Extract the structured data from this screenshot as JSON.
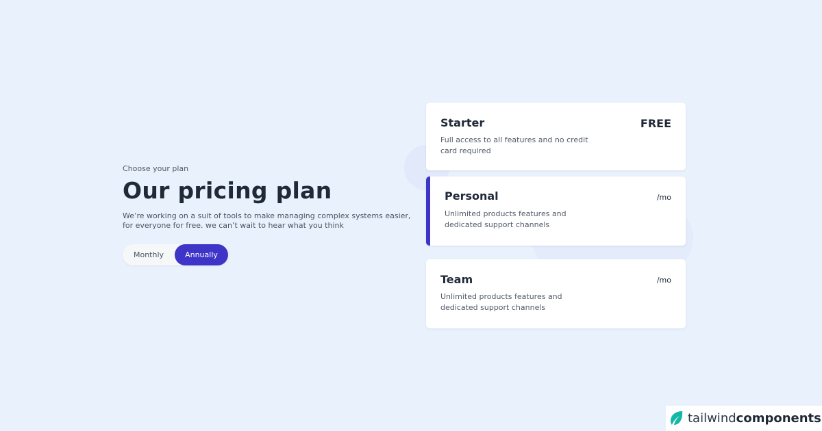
{
  "hero": {
    "eyebrow": "Choose your plan",
    "title": "Our pricing plan",
    "description": "We’re working on a suit of tools to make managing complex systems easier, for everyone for free. we can’t wait to hear what you think"
  },
  "billing_toggle": {
    "options": [
      "Monthly",
      "Annually"
    ],
    "selected": "Annually"
  },
  "plans": [
    {
      "name": "Starter",
      "price": "FREE",
      "description": "Full access to all features and no credit card required",
      "highlighted": false
    },
    {
      "name": "Personal",
      "price": "/mo",
      "description": "Unlimited products features and dedicated support channels",
      "highlighted": true
    },
    {
      "name": "Team",
      "price": "/mo",
      "description": "Unlimited products features and dedicated support channels",
      "highlighted": false
    }
  ],
  "brand": {
    "prefix": "tailwind",
    "suffix": "components",
    "icon": "leaf-icon"
  },
  "colors": {
    "background": "#e8f1fc",
    "accent": "#3e34c7",
    "brand_icon": "#14b8a6"
  }
}
